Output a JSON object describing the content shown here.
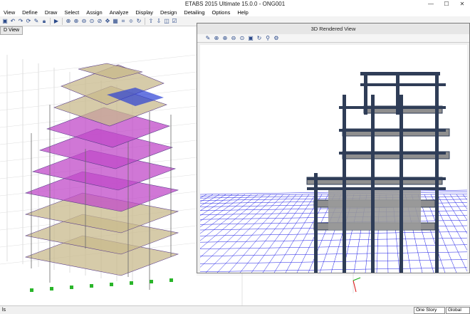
{
  "window": {
    "title": "ETABS 2015 Ultimate 15.0.0 - ONG001"
  },
  "menu": [
    "View",
    "Define",
    "Draw",
    "Select",
    "Assign",
    "Analyze",
    "Display",
    "Design",
    "Detailing",
    "Options",
    "Help"
  ],
  "left_view": {
    "tab_label": "D View"
  },
  "right_view": {
    "title": "3D Rendered View"
  },
  "status": {
    "left_text": "ls",
    "story_select": "One Story",
    "coord_select": "Global"
  },
  "colors": {
    "slab_magenta": "#c04ac8",
    "slab_tan": "#c8b98c",
    "frame_dark": "#2f3d57",
    "grid_blue": "#1a1ae6",
    "concrete_grey": "#8f8f8f"
  }
}
